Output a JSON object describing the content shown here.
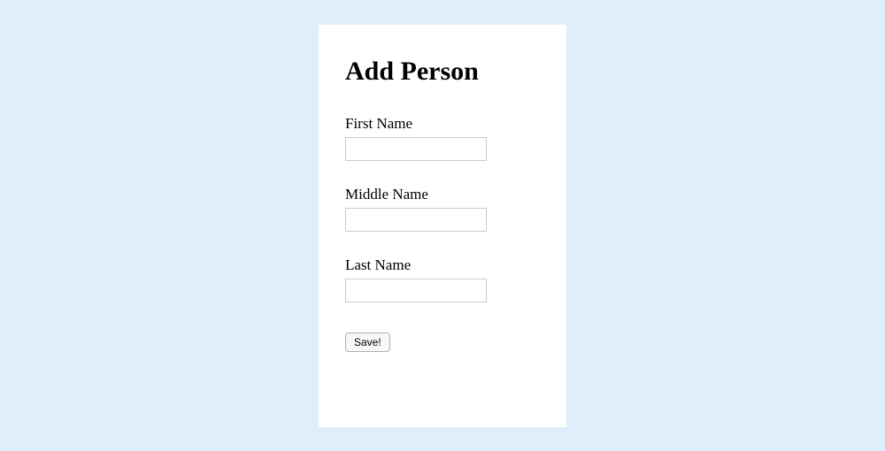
{
  "form": {
    "title": "Add Person",
    "fields": {
      "first_name": {
        "label": "First Name",
        "value": ""
      },
      "middle_name": {
        "label": "Middle Name",
        "value": ""
      },
      "last_name": {
        "label": "Last Name",
        "value": ""
      }
    },
    "save_label": "Save!"
  }
}
